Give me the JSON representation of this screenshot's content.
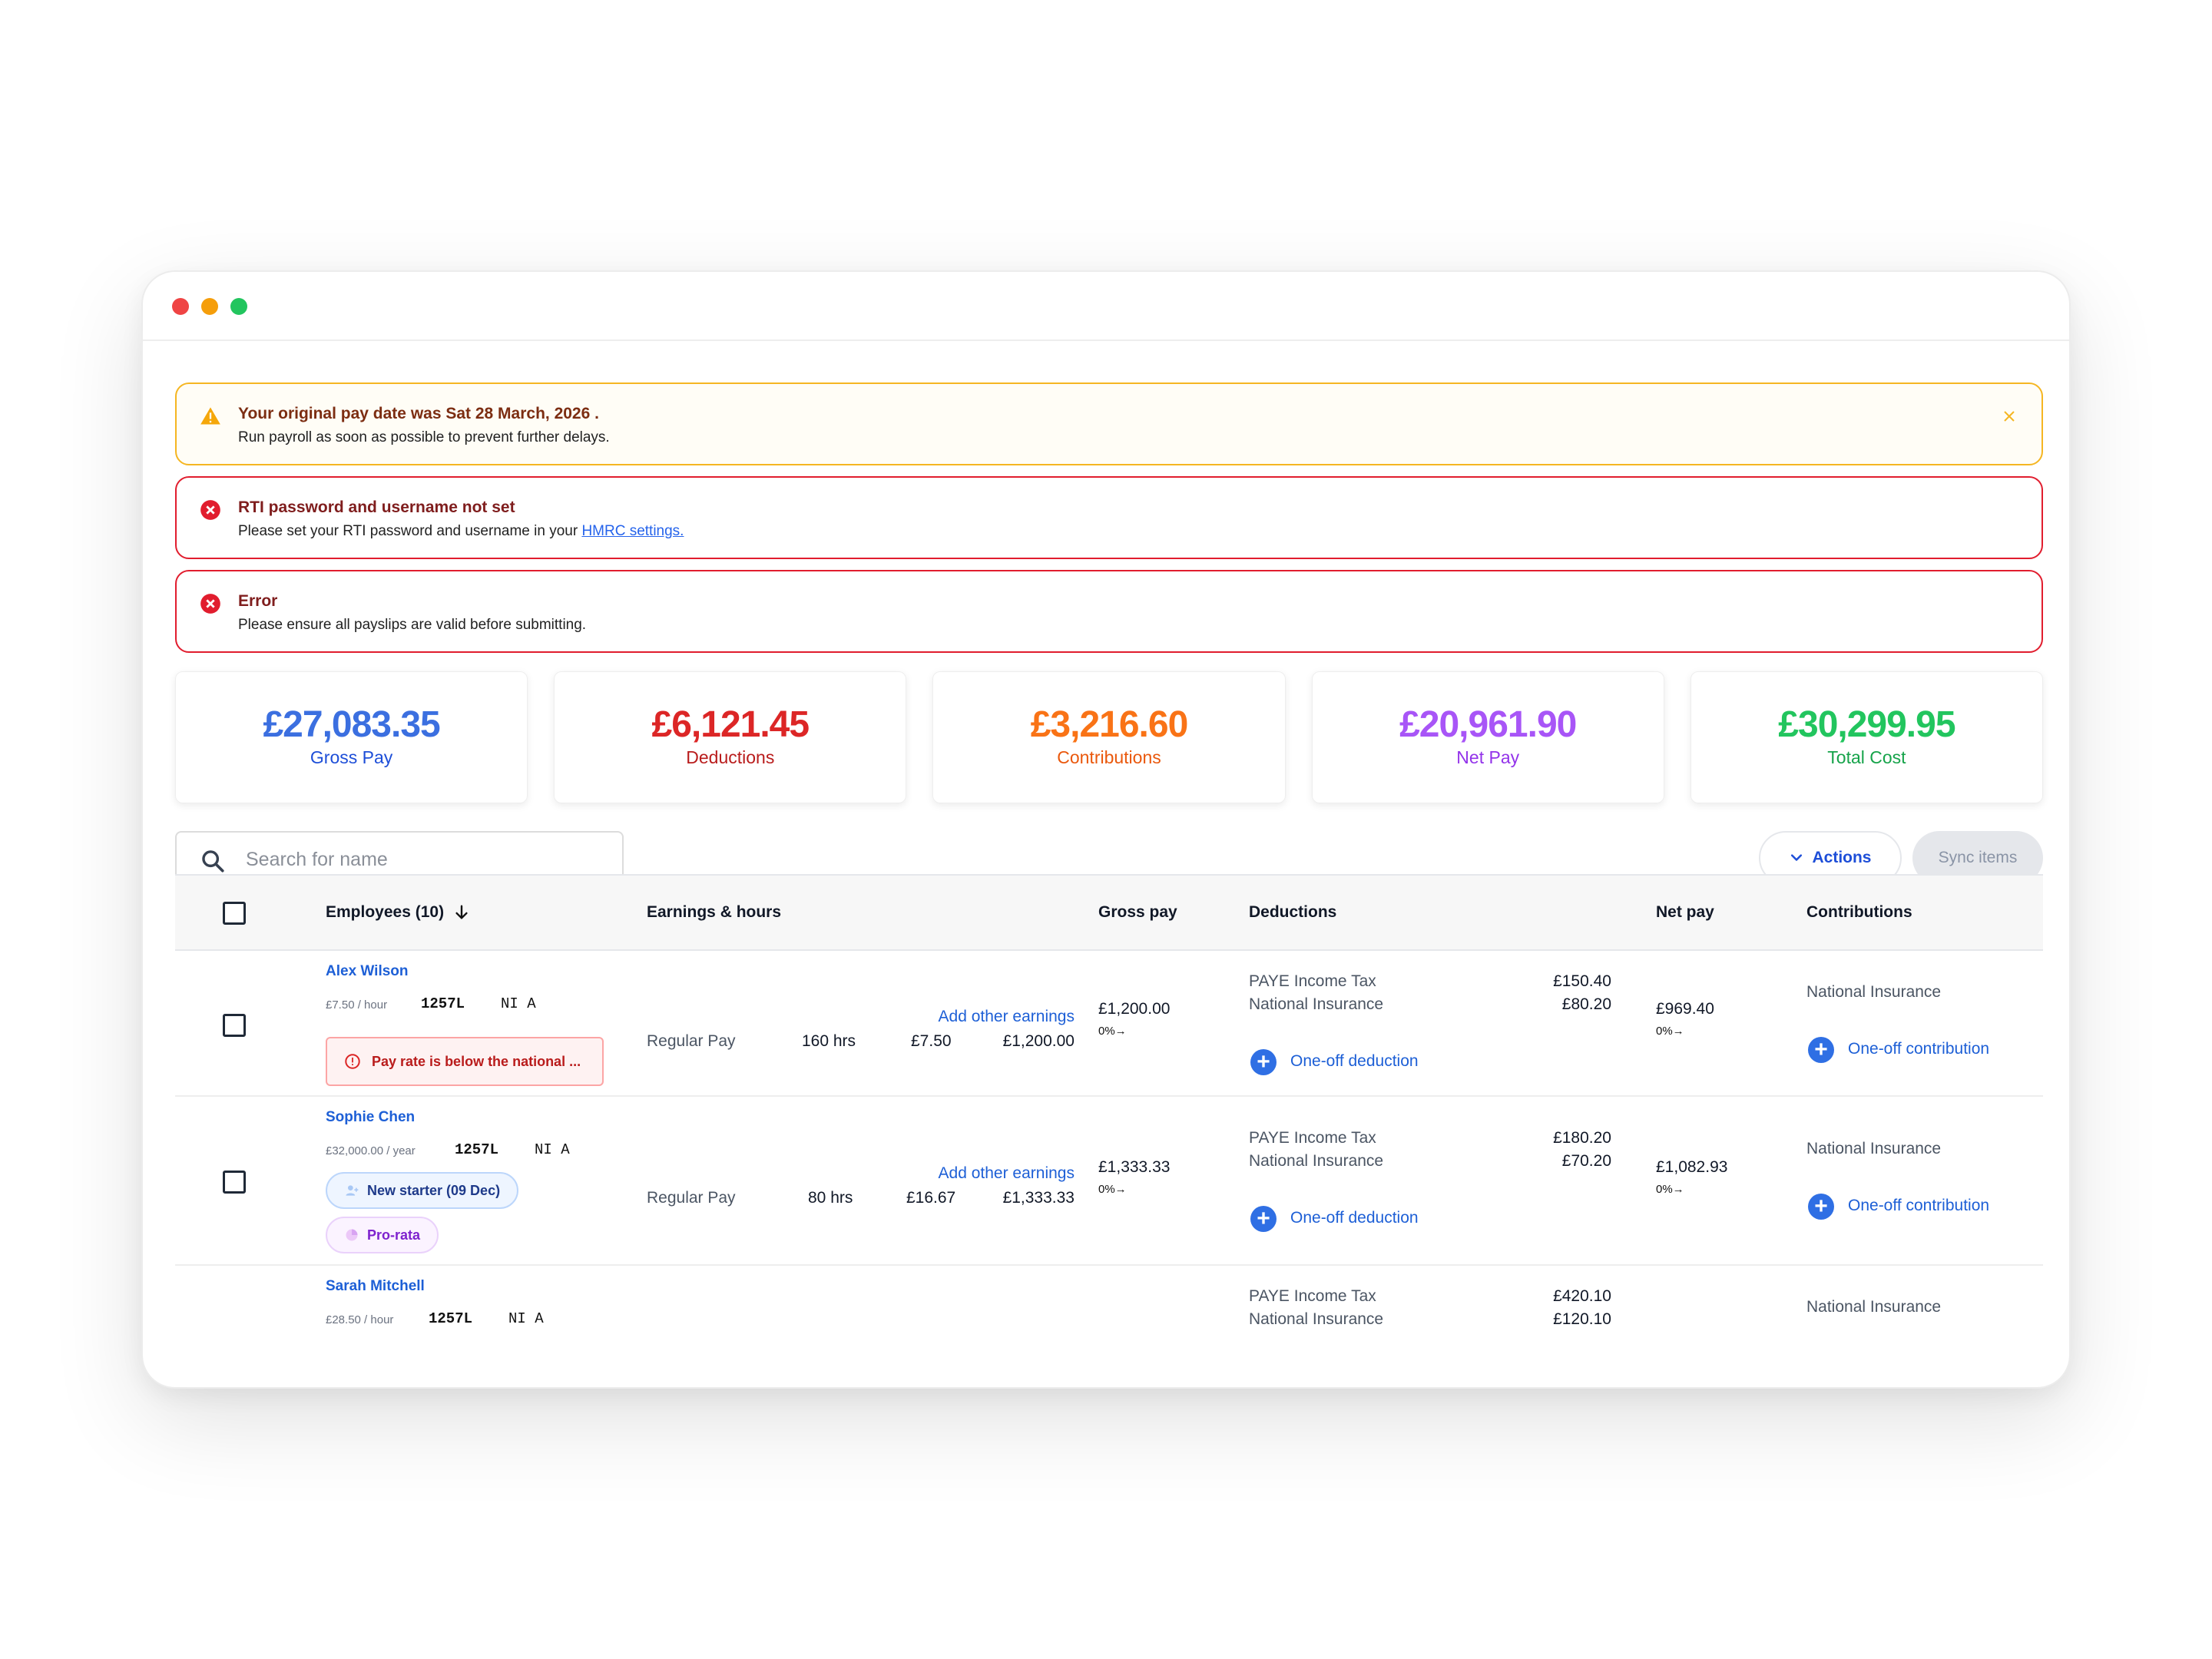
{
  "alerts": {
    "warning": {
      "title": "Your original pay date was Sat 28 March, 2026 .",
      "message": "Run payroll as soon as possible to prevent further delays."
    },
    "rti": {
      "title": "RTI password and username not set",
      "message": "Please set your RTI password and username in your ",
      "link": "HMRC settings."
    },
    "error": {
      "title": "Error",
      "message": "Please ensure all payslips are valid before submitting."
    }
  },
  "stats": [
    {
      "value": "£27,083.35",
      "label": "Gross Pay",
      "color": "#3b6fe0",
      "label_color": "#1d4ed8"
    },
    {
      "value": "£6,121.45",
      "label": "Deductions",
      "color": "#dc2626",
      "label_color": "#b91c1c"
    },
    {
      "value": "£3,216.60",
      "label": "Contributions",
      "color": "#f97316",
      "label_color": "#ea580c"
    },
    {
      "value": "£20,961.90",
      "label": "Net Pay",
      "color": "#a855f7",
      "label_color": "#9333ea"
    },
    {
      "value": "£30,299.95",
      "label": "Total Cost",
      "color": "#22c55e",
      "label_color": "#16a34a"
    }
  ],
  "toolbar": {
    "search_placeholder": "Search for name",
    "actions_label": "Actions",
    "sync_label": "Sync items"
  },
  "table": {
    "headers": {
      "employees": "Employees (10)",
      "earnings": "Earnings & hours",
      "gross": "Gross pay",
      "deductions": "Deductions",
      "net": "Net pay",
      "contributions": "Contributions"
    },
    "rows": [
      {
        "name": "Alex Wilson",
        "rate": "£7.50 / hour",
        "tax_code": "1257L",
        "ni": "NI A",
        "warning": "Pay rate is below the national ...",
        "earning_type": "Regular Pay",
        "hours": "160 hrs",
        "add_earnings": "Add other earnings",
        "unit_rate": "£7.50",
        "amount": "£1,200.00",
        "gross": "£1,200.00",
        "gross_pct": "0%→",
        "deduction1": "PAYE Income Tax",
        "deduction1_val": "£150.40",
        "deduction2": "National Insurance",
        "deduction2_val": "£80.20",
        "deduction_link": "One-off deduction",
        "net": "£969.40",
        "net_pct": "0%→",
        "contribution": "National Insurance",
        "contribution_link": "One-off contribution"
      },
      {
        "name": "Sophie Chen",
        "rate": "£32,000.00 / year",
        "tax_code": "1257L",
        "ni": "NI A",
        "badge1": "New starter (09 Dec)",
        "badge2": "Pro-rata",
        "earning_type": "Regular Pay",
        "hours": "80 hrs",
        "add_earnings": "Add other earnings",
        "unit_rate": "£16.67",
        "amount": "£1,333.33",
        "gross": "£1,333.33",
        "gross_pct": "0%→",
        "deduction1": "PAYE Income Tax",
        "deduction1_val": "£180.20",
        "deduction2": "National Insurance",
        "deduction2_val": "£70.20",
        "deduction_link": "One-off deduction",
        "net": "£1,082.93",
        "net_pct": "0%→",
        "contribution": "National Insurance",
        "contribution_link": "One-off contribution"
      },
      {
        "name": "Sarah Mitchell",
        "rate": "£28.50 / hour",
        "tax_code": "1257L",
        "ni": "NI A",
        "deduction1": "PAYE Income Tax",
        "deduction1_val": "£420.10",
        "deduction2": "National Insurance",
        "deduction2_val": "£120.10",
        "contribution": "National Insurance"
      }
    ]
  }
}
